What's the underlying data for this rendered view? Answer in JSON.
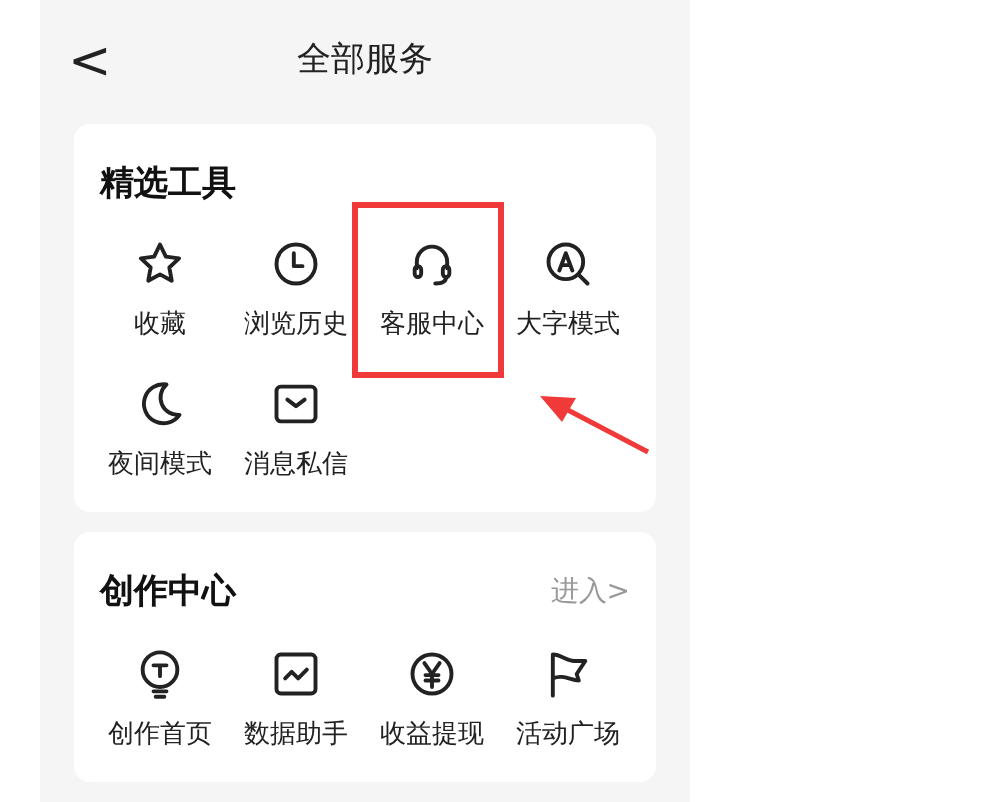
{
  "header": {
    "back": "<",
    "title": "全部服务"
  },
  "sections": [
    {
      "title": "精选工具",
      "items": [
        {
          "label": "收藏",
          "highlighted": false
        },
        {
          "label": "浏览历史",
          "highlighted": false
        },
        {
          "label": "客服中心",
          "highlighted": true
        },
        {
          "label": "大字模式",
          "highlighted": false
        },
        {
          "label": "夜间模式",
          "highlighted": false
        },
        {
          "label": "消息私信",
          "highlighted": false
        }
      ]
    },
    {
      "title": "创作中心",
      "link": "进入>",
      "items": [
        {
          "label": "创作首页",
          "highlighted": false
        },
        {
          "label": "数据助手",
          "highlighted": false
        },
        {
          "label": "收益提现",
          "highlighted": false
        },
        {
          "label": "活动广场",
          "highlighted": false
        }
      ]
    }
  ]
}
